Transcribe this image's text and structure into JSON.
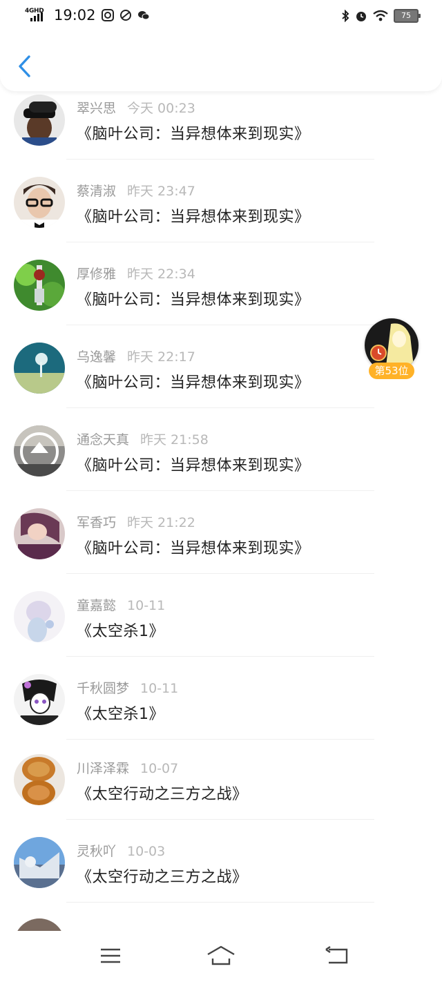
{
  "status_bar": {
    "network": "4GHD",
    "time": "19:02",
    "battery": "75"
  },
  "header": {
    "back_icon": "chevron-left-icon"
  },
  "floating_rank": {
    "label": "第53位"
  },
  "items": [
    {
      "name": "翠兴思",
      "date": "今天 00:23",
      "title": "《脑叶公司：当异想体来到现实》"
    },
    {
      "name": "蔡清淑",
      "date": "昨天 23:47",
      "title": "《脑叶公司：当异想体来到现实》"
    },
    {
      "name": "厚修雅",
      "date": "昨天 22:34",
      "title": "《脑叶公司：当异想体来到现实》"
    },
    {
      "name": "乌逸馨",
      "date": "昨天 22:17",
      "title": "《脑叶公司：当异想体来到现实》"
    },
    {
      "name": "通念天真",
      "date": "昨天 21:58",
      "title": "《脑叶公司：当异想体来到现实》"
    },
    {
      "name": "军香巧",
      "date": "昨天 21:22",
      "title": "《脑叶公司：当异想体来到现实》"
    },
    {
      "name": "童嘉懿",
      "date": "10-11",
      "title": "《太空杀1》"
    },
    {
      "name": "千秋圆梦",
      "date": "10-11",
      "title": "《太空杀1》"
    },
    {
      "name": "川泽泽霖",
      "date": "10-07",
      "title": "《太空行动之三方之战》"
    },
    {
      "name": "灵秋吖",
      "date": "10-03",
      "title": "《太空行动之三方之战》"
    }
  ],
  "colors": {
    "accent": "#2f8fe6",
    "badge": "#ffb227",
    "name_gray": "#9a9a9a",
    "date_gray": "#b8b8b8"
  },
  "nav": {
    "menu_icon": "menu-icon",
    "home_icon": "home-icon",
    "back_icon": "return-icon"
  }
}
